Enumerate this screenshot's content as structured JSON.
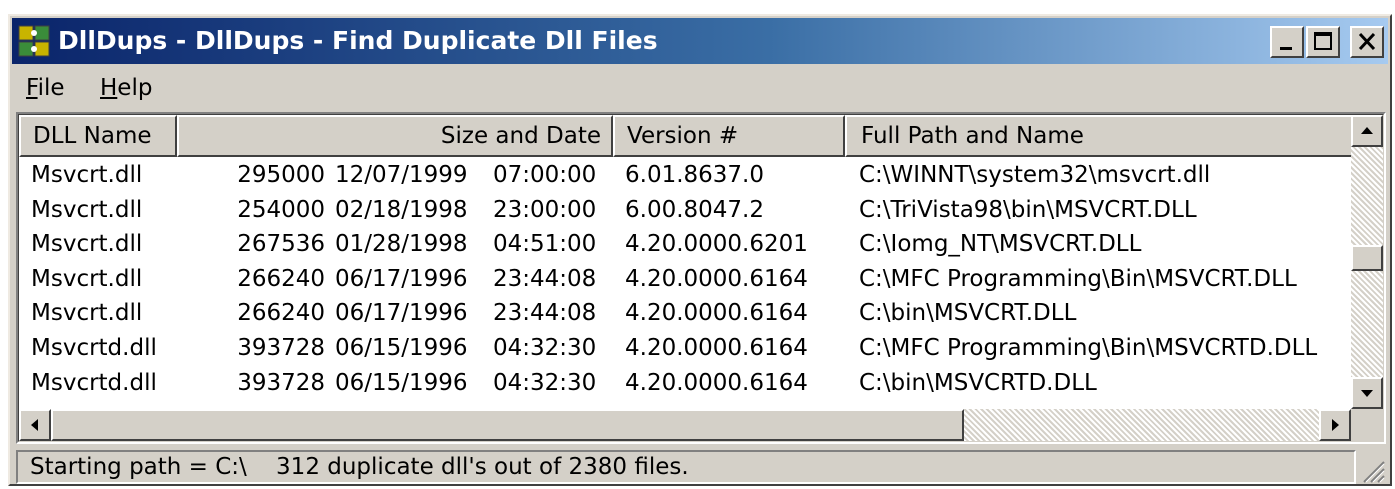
{
  "window": {
    "title": "DllDups - DllDups - Find Duplicate Dll Files",
    "icon": "dll-puzzle-icon",
    "controls": [
      "minimize-icon",
      "maximize-icon",
      "close-icon"
    ]
  },
  "menu": {
    "file": {
      "accel": "F",
      "rest": "ile"
    },
    "help": {
      "accel": "H",
      "rest": "elp"
    }
  },
  "table": {
    "columns": [
      {
        "label": "DLL Name"
      },
      {
        "label": "Size and Date"
      },
      {
        "label": "Version #"
      },
      {
        "label": "Full Path and Name"
      }
    ],
    "rows": [
      {
        "name": "Msvcrt.dll",
        "size": "295000",
        "date": "12/07/1999",
        "time": "07:00:00",
        "version": "6.01.8637.0",
        "path": "C:\\WINNT\\system32\\msvcrt.dll"
      },
      {
        "name": "Msvcrt.dll",
        "size": "254000",
        "date": "02/18/1998",
        "time": "23:00:00",
        "version": "6.00.8047.2",
        "path": "C:\\TriVista98\\bin\\MSVCRT.DLL"
      },
      {
        "name": "Msvcrt.dll",
        "size": "267536",
        "date": "01/28/1998",
        "time": "04:51:00",
        "version": "4.20.0000.6201",
        "path": "C:\\Iomg_NT\\MSVCRT.DLL"
      },
      {
        "name": "Msvcrt.dll",
        "size": "266240",
        "date": "06/17/1996",
        "time": "23:44:08",
        "version": "4.20.0000.6164",
        "path": "C:\\MFC Programming\\Bin\\MSVCRT.DLL"
      },
      {
        "name": "Msvcrt.dll",
        "size": "266240",
        "date": "06/17/1996",
        "time": "23:44:08",
        "version": "4.20.0000.6164",
        "path": "C:\\bin\\MSVCRT.DLL"
      },
      {
        "name": "Msvcrtd.dll",
        "size": "393728",
        "date": "06/15/1996",
        "time": "04:32:30",
        "version": "4.20.0000.6164",
        "path": "C:\\MFC Programming\\Bin\\MSVCRTD.DLL"
      },
      {
        "name": "Msvcrtd.dll",
        "size": "393728",
        "date": "06/15/1996",
        "time": "04:32:30",
        "version": "4.20.0000.6164",
        "path": "C:\\bin\\MSVCRTD.DLL"
      }
    ]
  },
  "scrollbars": {
    "vertical": {
      "up": "arrow-up-icon",
      "down": "arrow-down-icon",
      "thumb_position": 0.48
    },
    "horizontal": {
      "left": "arrow-left-icon",
      "right": "arrow-right-icon",
      "thumb_fraction": 0.72
    }
  },
  "status": {
    "text": "Starting path = C:\\    312 duplicate dll's out of 2380 files."
  },
  "colors": {
    "titlebar_start": "#0a246a",
    "titlebar_end": "#a6caf0",
    "face": "#d4d0c8"
  }
}
